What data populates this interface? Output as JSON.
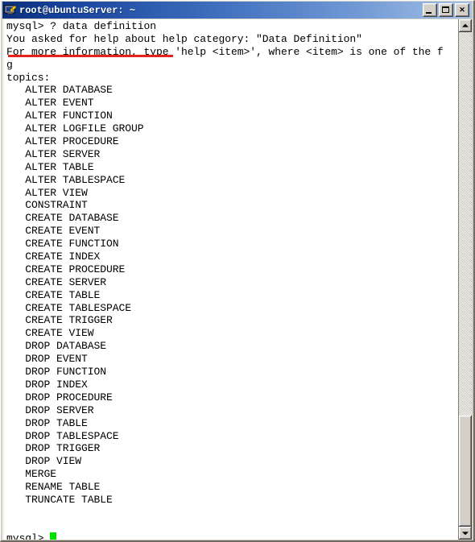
{
  "window": {
    "title": "root@ubuntuServer: ~",
    "icon": "putty-terminal-icon",
    "buttons": {
      "minimize_label": "_",
      "maximize_label": "□",
      "close_label": "✕"
    }
  },
  "terminal": {
    "prompt_line": "mysql> ? data definition",
    "lines": [
      "mysql> ? data definition",
      "You asked for help about help category: \"Data Definition\"",
      "For more information, type 'help <item>', where <item> is one of the f",
      "g",
      "topics:",
      "   ALTER DATABASE",
      "   ALTER EVENT",
      "   ALTER FUNCTION",
      "   ALTER LOGFILE GROUP",
      "   ALTER PROCEDURE",
      "   ALTER SERVER",
      "   ALTER TABLE",
      "   ALTER TABLESPACE",
      "   ALTER VIEW",
      "   CONSTRAINT",
      "   CREATE DATABASE",
      "   CREATE EVENT",
      "   CREATE FUNCTION",
      "   CREATE INDEX",
      "   CREATE PROCEDURE",
      "   CREATE SERVER",
      "   CREATE TABLE",
      "   CREATE TABLESPACE",
      "   CREATE TRIGGER",
      "   CREATE VIEW",
      "   DROP DATABASE",
      "   DROP EVENT",
      "   DROP FUNCTION",
      "   DROP INDEX",
      "   DROP PROCEDURE",
      "   DROP SERVER",
      "   DROP TABLE",
      "   DROP TABLESPACE",
      "   DROP TRIGGER",
      "   DROP VIEW",
      "   MERGE",
      "   RENAME TABLE",
      "   TRUNCATE TABLE",
      "",
      ""
    ],
    "final_prompt": "mysql> ",
    "cursor": "block-cursor",
    "cursor_color": "#00e000",
    "text_color": "#000000",
    "background_color": "#ffffff",
    "annotation": {
      "type": "red-underline",
      "color": "#e8211a",
      "target_text": "mysql> ? data definition"
    }
  },
  "scrollbar": {
    "up_arrow": "scroll-up-arrow",
    "down_arrow": "scroll-down-arrow",
    "thumb": "scrollbar-thumb"
  }
}
